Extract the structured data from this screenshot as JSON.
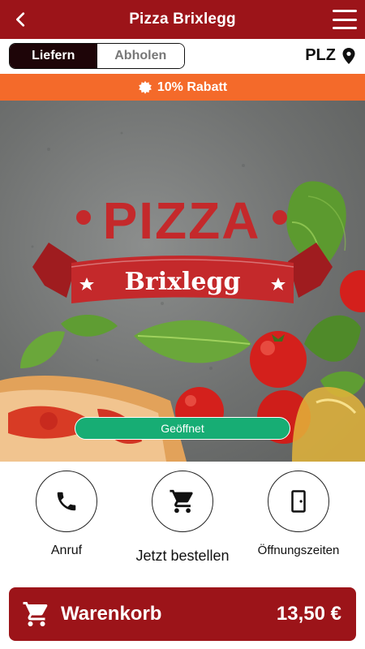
{
  "header": {
    "title": "Pizza Brixlegg",
    "back_icon": "chevron-left-icon",
    "menu_icon": "hamburger-menu-icon",
    "background_color": "#9c1419"
  },
  "mode_toggle": {
    "options": [
      "Liefern",
      "Abholen"
    ],
    "selected": "Liefern"
  },
  "postal_code": {
    "label": "PLZ",
    "icon": "location-pin-icon"
  },
  "promo": {
    "text": "10% Rabatt",
    "icon": "badge-icon",
    "background_color": "#f46a2a"
  },
  "hero": {
    "logo_title": "PIZZA",
    "logo_subtitle": "Brixlegg",
    "status": "Geöffnet",
    "status_color": "#17ad74"
  },
  "actions": [
    {
      "label": "Anruf",
      "icon": "phone-icon"
    },
    {
      "label": "Jetzt bestellen",
      "icon": "shopping-cart-icon"
    },
    {
      "label": "Öffnungszeiten",
      "icon": "door-icon"
    }
  ],
  "cart": {
    "label": "Warenkorb",
    "total": "13,50 €",
    "icon": "shopping-cart-icon"
  }
}
